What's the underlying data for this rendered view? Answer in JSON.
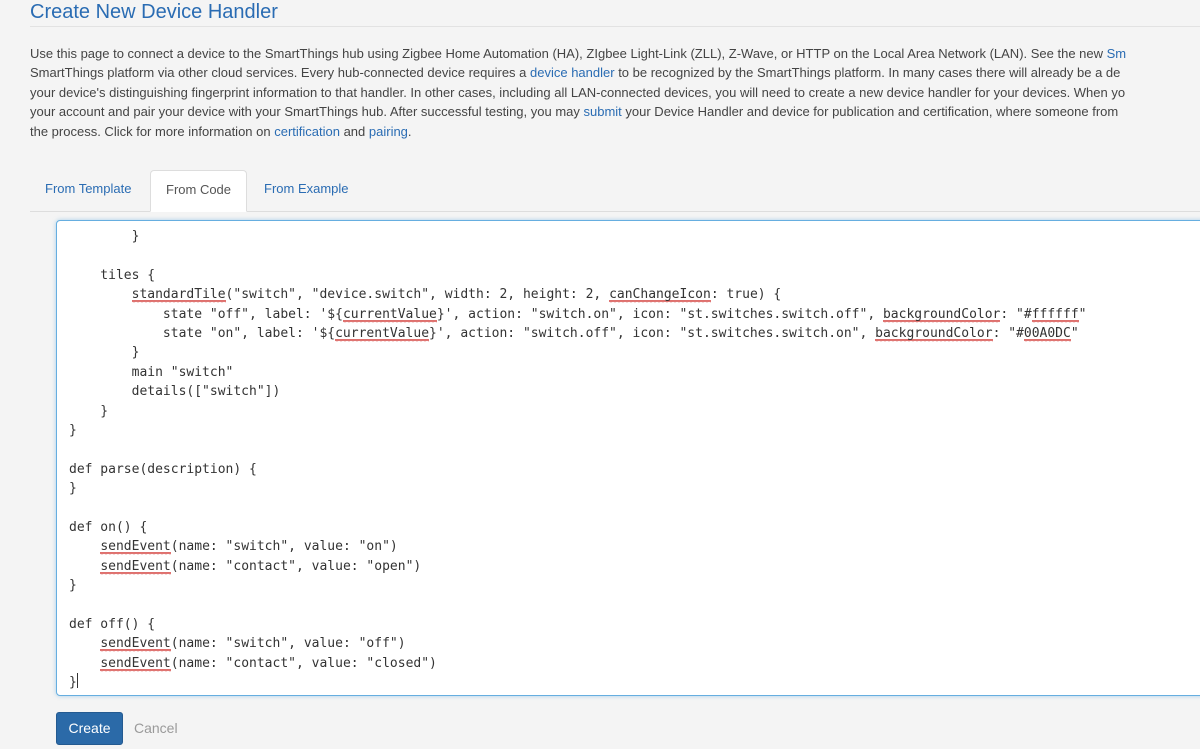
{
  "page": {
    "title": "Create New Device Handler"
  },
  "intro": {
    "line1_text": "Use this page to connect a device to the SmartThings hub using Zigbee Home Automation (HA), ZIgbee Light-Link (ZLL), Z-Wave, or HTTP on the Local Area Network (LAN). See the new ",
    "line1_link": "Sm",
    "line2_a": "SmartThings platform via other cloud services. Every hub-connected device requires a ",
    "line2_link": "device handler",
    "line2_b": " to be recognized by the SmartThings platform. In many cases there will already be a de",
    "line3": "your device's distinguishing fingerprint information to that handler. In other cases, including all LAN-connected devices, you will need to create a new device handler for your devices. When yo",
    "line4_a": "your account and pair your device with your SmartThings hub. After successful testing, you may ",
    "line4_link": "submit",
    "line4_b": " your Device Handler and device for publication and certification, where someone from",
    "line5_a": "the process. Click for more information on ",
    "line5_link1": "certification",
    "line5_and": " and ",
    "line5_link2": "pairing",
    "line5_end": "."
  },
  "tabs": [
    {
      "label": "From Template",
      "active": false
    },
    {
      "label": "From Code",
      "active": true
    },
    {
      "label": "From Example",
      "active": false
    }
  ],
  "editor": {
    "lines": [
      "        }",
      "",
      "    tiles {",
      "        standardTile(\"switch\", \"device.switch\", width: 2, height: 2, canChangeIcon: true) {",
      "            state \"off\", label: '${currentValue}', action: \"switch.on\", icon: \"st.switches.switch.off\", backgroundColor: \"#ffffff\"",
      "            state \"on\", label: '${currentValue}', action: \"switch.off\", icon: \"st.switches.switch.on\", backgroundColor: \"#00A0DC\"",
      "        }",
      "        main \"switch\"",
      "        details([\"switch\"])",
      "    }",
      "}",
      "",
      "def parse(description) {",
      "}",
      "",
      "def on() {",
      "    sendEvent(name: \"switch\", value: \"on\")",
      "    sendEvent(name: \"contact\", value: \"open\")",
      "}",
      "",
      "def off() {",
      "    sendEvent(name: \"switch\", value: \"off\")",
      "    sendEvent(name: \"contact\", value: \"closed\")",
      "}"
    ],
    "spellcheck_words": [
      "standardTile",
      "canChangeIcon",
      "currentValue",
      "backgroundColor",
      "ffffff",
      "00A0DC",
      "sendEvent"
    ],
    "spellcheck_color": "#d0312d"
  },
  "actions": {
    "create_label": "Create",
    "cancel_label": "Cancel"
  },
  "colors": {
    "link": "#2a6cb3",
    "primary_button": "#2b6aa8",
    "editor_focus_border": "#66aee0"
  }
}
